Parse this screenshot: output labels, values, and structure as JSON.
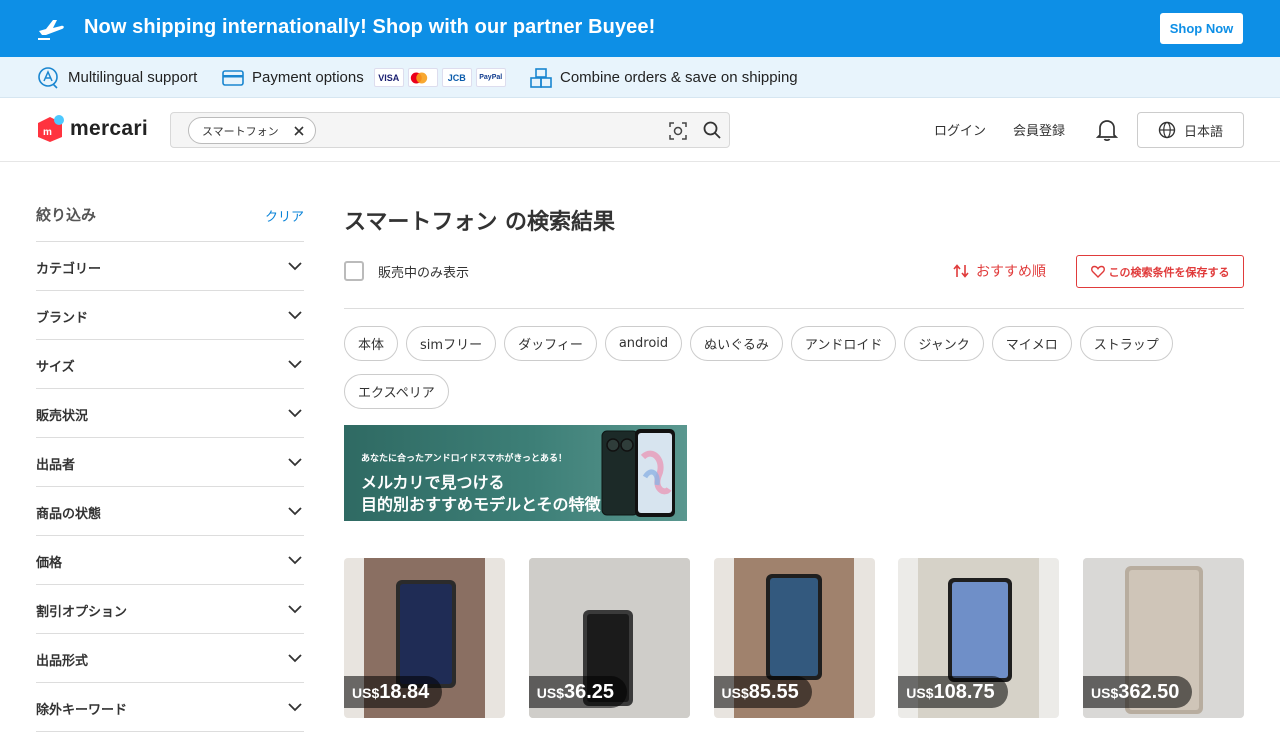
{
  "promo": {
    "text": "Now shipping internationally! Shop with our partner Buyee!",
    "button": "Shop Now"
  },
  "features": {
    "multilingual": "Multilingual support",
    "payment": "Payment options",
    "cards": [
      "VISA",
      "MC",
      "JCB",
      "PayPal"
    ],
    "combine": "Combine orders & save on shipping"
  },
  "header": {
    "logo": "mercari",
    "search_chip": "スマートフォン",
    "login": "ログイン",
    "register": "会員登録",
    "language": "日本語"
  },
  "sidebar": {
    "title": "絞り込み",
    "clear": "クリア",
    "filters": [
      "カテゴリー",
      "ブランド",
      "サイズ",
      "販売状況",
      "出品者",
      "商品の状態",
      "価格",
      "割引オプション",
      "出品形式",
      "除外キーワード"
    ]
  },
  "main": {
    "title": "スマートフォン の検索結果",
    "on_sale_only": "販売中のみ表示",
    "sort": "おすすめ順",
    "save_search": "この検索条件を保存する",
    "tags": [
      "本体",
      "simフリー",
      "ダッフィー",
      "android",
      "ぬいぐるみ",
      "アンドロイド",
      "ジャンク",
      "マイメロ",
      "ストラップ",
      "エクスペリア"
    ],
    "ad": {
      "small": "あなたに合ったアンドロイドスマホがきっとある！",
      "line1": "メルカリで見つける",
      "line2": "目的別おすすめモデルとその特徴"
    },
    "products": [
      {
        "currency": "US$",
        "price": "18.84"
      },
      {
        "currency": "US$",
        "price": "36.25"
      },
      {
        "currency": "US$",
        "price": "85.55"
      },
      {
        "currency": "US$",
        "price": "108.75"
      },
      {
        "currency": "US$",
        "price": "362.50"
      }
    ]
  },
  "colors": {
    "promo_blue": "#0d8fe6",
    "accent_red": "#e03b3b",
    "link_blue": "#0b84d8"
  }
}
